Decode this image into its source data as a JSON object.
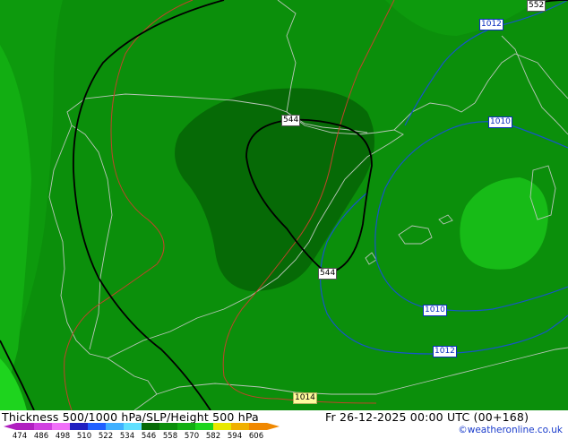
{
  "map": {
    "background_color": "#0d9a0d",
    "thickness_bands": [
      {
        "name": "band-546-558",
        "color": "#0b8f0b"
      },
      {
        "name": "band-534-546",
        "color": "#066a06"
      },
      {
        "name": "band-558-570-east",
        "color": "#17bb17"
      },
      {
        "name": "band-558-570-nw",
        "color": "#12ae12"
      },
      {
        "name": "band-558-570-corner",
        "color": "#1ed41e"
      }
    ],
    "contour_labels": [
      {
        "id": "lab-552",
        "text": "552",
        "style": "white"
      },
      {
        "id": "lab-544-top",
        "text": "544",
        "style": "white"
      },
      {
        "id": "lab-544-bottom",
        "text": "544",
        "style": "white"
      },
      {
        "id": "lab-1012-top",
        "text": "1012",
        "style": "blue"
      },
      {
        "id": "lab-1010-right",
        "text": "1010",
        "style": "blue"
      },
      {
        "id": "lab-1010-bottom",
        "text": "1010",
        "style": "blue"
      },
      {
        "id": "lab-1012-bottom",
        "text": "1012",
        "style": "blue"
      },
      {
        "id": "lab-1014",
        "text": "1014",
        "style": "yellow"
      }
    ],
    "line_colors": {
      "height_500": "#000000",
      "slp": "#1655c9",
      "slp_warm": "#c0442a",
      "coast": "#b9c6b9"
    }
  },
  "footer": {
    "title": "Thickness 500/1000 hPa/SLP/Height 500 hPa",
    "datetime": "Fr 26-12-2025 00:00 UTC (00+168)",
    "credit": "©weatheronline.co.uk",
    "legend": {
      "colors": [
        "#b020c0",
        "#d040e0",
        "#f070f8",
        "#2020c0",
        "#2060ff",
        "#40b0ff",
        "#60e0ff",
        "#066a06",
        "#0b8f0b",
        "#12ae12",
        "#1ed41e",
        "#e8e800",
        "#f0b000",
        "#f08800"
      ],
      "ticks": [
        "474",
        "486",
        "498",
        "510",
        "522",
        "534",
        "546",
        "558",
        "570",
        "582",
        "594",
        "606"
      ]
    }
  }
}
